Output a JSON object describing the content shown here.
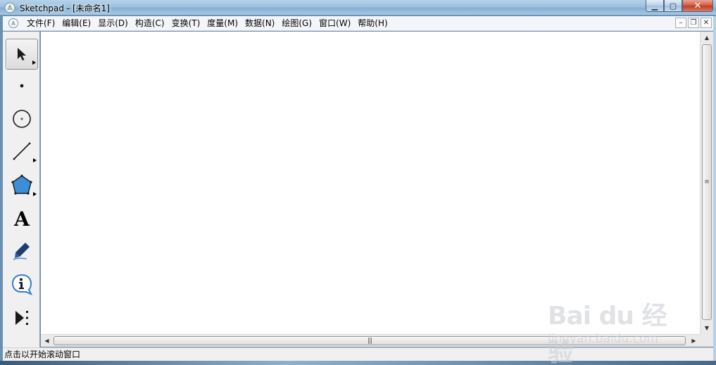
{
  "window": {
    "title": "Sketchpad  - [未命名1]",
    "controls": {
      "minimize": "▁",
      "maximize": "▢",
      "close": "✕"
    }
  },
  "menubar": {
    "items": [
      {
        "label": "文件(F)"
      },
      {
        "label": "编辑(E)"
      },
      {
        "label": "显示(D)"
      },
      {
        "label": "构造(C)"
      },
      {
        "label": "变换(T)"
      },
      {
        "label": "度量(M)"
      },
      {
        "label": "数据(N)"
      },
      {
        "label": "绘图(G)"
      },
      {
        "label": "窗口(W)"
      },
      {
        "label": "帮助(H)"
      }
    ],
    "mdi_controls": {
      "minimize": "–",
      "restore": "❐",
      "close": "✕"
    }
  },
  "toolbox": {
    "active_tool": "arrow",
    "tools": [
      {
        "id": "arrow",
        "icon": "arrow-select-icon",
        "has_submenu": true
      },
      {
        "id": "point",
        "icon": "point-icon",
        "has_submenu": false
      },
      {
        "id": "compass",
        "icon": "compass-circle-icon",
        "has_submenu": false
      },
      {
        "id": "straightedge",
        "icon": "line-segment-icon",
        "has_submenu": true
      },
      {
        "id": "polygon",
        "icon": "pentagon-icon",
        "has_submenu": true
      },
      {
        "id": "text",
        "icon": "text-icon",
        "glyph": "A",
        "has_submenu": false
      },
      {
        "id": "marker",
        "icon": "marker-pen-icon",
        "has_submenu": false
      },
      {
        "id": "information",
        "icon": "info-icon",
        "has_submenu": false
      },
      {
        "id": "custom",
        "icon": "custom-tool-icon",
        "has_submenu": false
      }
    ]
  },
  "scrollbars": {
    "vertical_grip": "≡",
    "horizontal_grip": "|||",
    "arrows": {
      "up": "▲",
      "down": "▼",
      "left": "◀",
      "right": "▶"
    }
  },
  "statusbar": {
    "text": "点击以开始滚动窗口"
  },
  "watermark": {
    "logo": "Bai du 经验",
    "url": "jingyan.baidu.com"
  },
  "colors": {
    "polygon_fill": "#3b8ed8",
    "marker_blue": "#2a5aa8",
    "info_blue": "#2d7fd0"
  }
}
